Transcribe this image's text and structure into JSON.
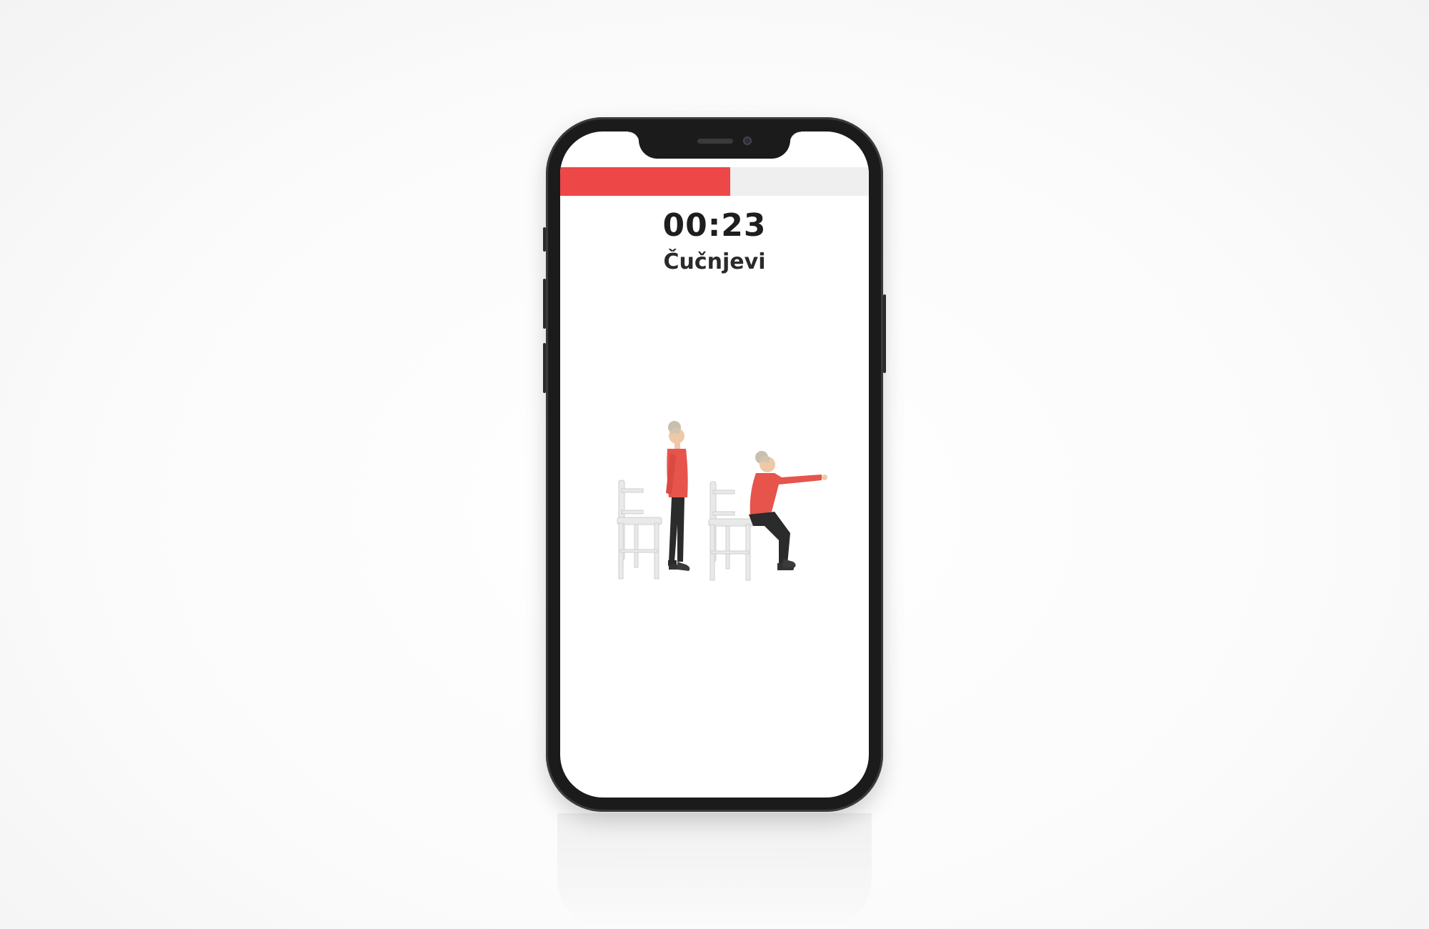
{
  "workout": {
    "timer": "00:23",
    "exercise_name": "Čučnjevi",
    "progress": 0.55
  },
  "colors": {
    "accent": "#ee4747",
    "track": "#efefef",
    "text": "#1e1e1e",
    "phone_frame": "#1b1b1b"
  },
  "illustration": {
    "icon": "squat-exercise-illustration"
  }
}
